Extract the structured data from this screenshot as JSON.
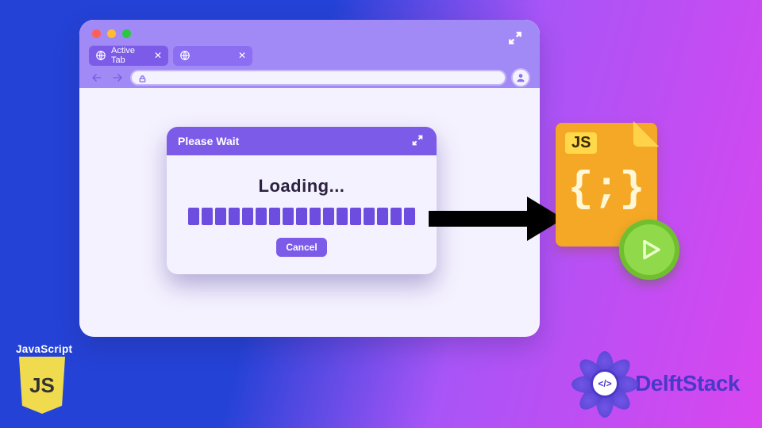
{
  "browser": {
    "tabs": [
      {
        "label": "Active Tab"
      },
      {
        "label": ""
      }
    ]
  },
  "dialog": {
    "title": "Please Wait",
    "loading_label": "Loading...",
    "cancel_label": "Cancel"
  },
  "jsfile": {
    "badge": "JS",
    "code_glyph": "{;}"
  },
  "jslogo": {
    "label": "JavaScript",
    "shield_text": "JS"
  },
  "delft": {
    "brand": "DelftStack",
    "center_glyph": "</>"
  },
  "icons": {
    "globe": "globe-icon",
    "close": "close-icon",
    "expand": "expand-icon",
    "back": "back-arrow-icon",
    "forward": "forward-arrow-icon",
    "lock": "lock-icon",
    "user": "user-icon",
    "play": "play-icon",
    "arrow": "right-arrow-icon"
  }
}
